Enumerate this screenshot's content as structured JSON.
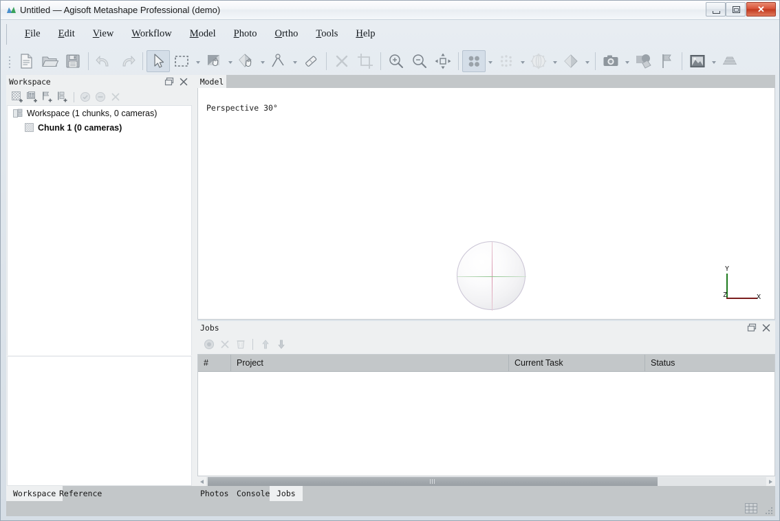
{
  "window": {
    "title": "Untitled — Agisoft Metashape Professional (demo)",
    "app_icon": "metashape-logo-icon",
    "controls": {
      "minimize": "minimize-button",
      "maximize": "maximize-button",
      "close": "close-button"
    }
  },
  "menubar": {
    "items": [
      {
        "label": "File",
        "mnemonic": "F"
      },
      {
        "label": "Edit",
        "mnemonic": "E"
      },
      {
        "label": "View",
        "mnemonic": "V"
      },
      {
        "label": "Workflow",
        "mnemonic": "W"
      },
      {
        "label": "Model",
        "mnemonic": "M"
      },
      {
        "label": "Photo",
        "mnemonic": "P"
      },
      {
        "label": "Ortho",
        "mnemonic": "O"
      },
      {
        "label": "Tools",
        "mnemonic": "T"
      },
      {
        "label": "Help",
        "mnemonic": "H"
      }
    ]
  },
  "toolbar": {
    "buttons": [
      {
        "name": "new-project-button",
        "icon": "new-document-icon",
        "enabled": true,
        "active": false,
        "dropdown": false
      },
      {
        "name": "open-project-button",
        "icon": "open-folder-icon",
        "enabled": true,
        "active": false,
        "dropdown": false
      },
      {
        "name": "save-project-button",
        "icon": "save-floppy-icon",
        "enabled": true,
        "active": false,
        "dropdown": false
      },
      {
        "name": "undo-button",
        "icon": "undo-arrow-icon",
        "enabled": false,
        "active": false,
        "dropdown": false
      },
      {
        "name": "redo-button",
        "icon": "redo-arrow-icon",
        "enabled": false,
        "active": false,
        "dropdown": false
      },
      {
        "name": "navigation-tool-button",
        "icon": "cursor-arrow-icon",
        "enabled": true,
        "active": true,
        "dropdown": false
      },
      {
        "name": "rectangle-selection-button",
        "icon": "dashed-rectangle-icon",
        "enabled": true,
        "active": false,
        "dropdown": true
      },
      {
        "name": "free-form-selection-button",
        "icon": "free-form-hand-icon",
        "enabled": true,
        "active": false,
        "dropdown": true
      },
      {
        "name": "shape-drawing-button",
        "icon": "polygon-hand-icon",
        "enabled": true,
        "active": false,
        "dropdown": true
      },
      {
        "name": "ruler-tool-button",
        "icon": "measure-path-icon",
        "enabled": true,
        "active": false,
        "dropdown": true
      },
      {
        "name": "eraser-tool-button",
        "icon": "eraser-icon",
        "enabled": true,
        "active": false,
        "dropdown": false
      },
      {
        "name": "delete-selection-button",
        "icon": "cross-x-icon",
        "enabled": false,
        "active": false,
        "dropdown": false
      },
      {
        "name": "crop-selection-button",
        "icon": "crop-icon",
        "enabled": false,
        "active": false,
        "dropdown": false
      },
      {
        "name": "zoom-in-button",
        "icon": "magnifier-plus-icon",
        "enabled": true,
        "active": false,
        "dropdown": false
      },
      {
        "name": "zoom-out-button",
        "icon": "magnifier-minus-icon",
        "enabled": true,
        "active": false,
        "dropdown": false
      },
      {
        "name": "reset-view-button",
        "icon": "fit-to-window-icon",
        "enabled": true,
        "active": false,
        "dropdown": false
      },
      {
        "name": "show-point-cloud-button",
        "icon": "four-dots-icon",
        "enabled": true,
        "active": true,
        "dropdown": true
      },
      {
        "name": "show-dense-cloud-button",
        "icon": "dense-dots-icon",
        "enabled": false,
        "active": false,
        "dropdown": true
      },
      {
        "name": "show-model-button",
        "icon": "mesh-sphere-icon",
        "enabled": false,
        "active": false,
        "dropdown": true
      },
      {
        "name": "show-tiled-model-button",
        "icon": "diamond-solid-icon",
        "enabled": true,
        "active": false,
        "dropdown": true
      },
      {
        "name": "show-cameras-button",
        "icon": "camera-icon",
        "enabled": true,
        "active": false,
        "dropdown": true
      },
      {
        "name": "show-shapes-button",
        "icon": "shapes-overlay-icon",
        "enabled": true,
        "active": false,
        "dropdown": false
      },
      {
        "name": "show-markers-button",
        "icon": "flag-icon",
        "enabled": true,
        "active": false,
        "dropdown": false
      },
      {
        "name": "show-texture-button",
        "icon": "texture-image-icon",
        "enabled": true,
        "active": false,
        "dropdown": true
      },
      {
        "name": "show-layers-button",
        "icon": "stacked-layers-icon",
        "enabled": true,
        "active": false,
        "dropdown": false
      }
    ]
  },
  "workspace_panel": {
    "title": "Workspace",
    "float_button": "float-panel-icon",
    "close_button": "close-panel-icon",
    "toolbar": [
      {
        "name": "add-chunk-button",
        "icon": "add-chunk-icon",
        "enabled": true
      },
      {
        "name": "add-photos-button",
        "icon": "add-photos-icon",
        "enabled": true
      },
      {
        "name": "add-markers-button",
        "icon": "add-marker-icon",
        "enabled": true
      },
      {
        "name": "add-scalebar-button",
        "icon": "add-scalebar-icon",
        "enabled": true
      },
      {
        "name": "enable-button",
        "icon": "enable-check-icon",
        "enabled": false
      },
      {
        "name": "disable-button",
        "icon": "disable-minus-icon",
        "enabled": false
      },
      {
        "name": "remove-items-button",
        "icon": "remove-x-icon",
        "enabled": false
      }
    ],
    "tree": [
      {
        "label": "Workspace (1 chunks, 0 cameras)",
        "icon": "workspace-root-icon",
        "bold": false,
        "indent": 0
      },
      {
        "label": "Chunk 1 (0 cameras)",
        "icon": "chunk-icon",
        "bold": true,
        "indent": 1
      }
    ]
  },
  "viewport": {
    "tab_label": "Model",
    "projection_label": "Perspective 30°",
    "gizmo": {
      "x_label": "X",
      "y_label": "Y",
      "z_label": "Z",
      "x_color": "#7a1d1d",
      "y_color": "#1d7a1d"
    },
    "trackball": {
      "name": "navigation-trackball",
      "vertical_line_color": "#d98fa8",
      "horizontal_line_color": "#8ec48e"
    }
  },
  "jobs_panel": {
    "title": "Jobs",
    "float_button": "float-panel-icon",
    "close_button": "close-panel-icon",
    "toolbar": [
      {
        "name": "start-job-button",
        "icon": "record-circle-icon",
        "enabled": false
      },
      {
        "name": "stop-job-button",
        "icon": "cross-x-icon",
        "enabled": false
      },
      {
        "name": "delete-job-button",
        "icon": "trash-bin-icon",
        "enabled": false
      },
      {
        "name": "move-job-up-button",
        "icon": "arrow-up-icon",
        "enabled": false
      },
      {
        "name": "move-job-down-button",
        "icon": "arrow-down-icon",
        "enabled": false
      }
    ],
    "columns": [
      "#",
      "Project",
      "Current Task",
      "Status"
    ],
    "rows": []
  },
  "bottom_tabs": {
    "left": [
      {
        "label": "Workspace",
        "selected": true
      },
      {
        "label": "Reference",
        "selected": false
      }
    ],
    "right": [
      {
        "label": "Photos",
        "selected": false
      },
      {
        "label": "Console",
        "selected": false
      },
      {
        "label": "Jobs",
        "selected": true
      }
    ]
  },
  "statusbar": {
    "icon": "grid-status-icon",
    "resize_grip": "resize-grip-icon"
  },
  "colors": {
    "window_bg": "#eef0f1",
    "panel_header": "#c3c7c9",
    "viewport_bg": "#ffffff",
    "close_button": "#c23a20",
    "axis_x": "#7a1d1d",
    "axis_y": "#1d7a1d"
  }
}
